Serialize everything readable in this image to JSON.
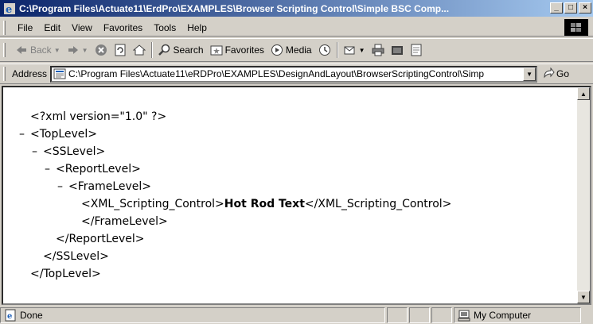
{
  "window": {
    "title": "C:\\Program Files\\Actuate11\\ErdPro\\EXAMPLES\\Browser Scripting Control\\Simple BSC Comp...",
    "controls": {
      "minimize": "_",
      "maximize": "□",
      "close": "×"
    }
  },
  "menu": {
    "items": [
      "File",
      "Edit",
      "View",
      "Favorites",
      "Tools",
      "Help"
    ]
  },
  "toolbar": {
    "back_label": "Back",
    "search_label": "Search",
    "favorites_label": "Favorites",
    "media_label": "Media"
  },
  "address": {
    "label": "Address",
    "url": "C:\\Program Files\\Actuate11\\eRDPro\\EXAMPLES\\DesignAndLayout\\BrowserScriptingControl\\Simp",
    "go_label": "Go"
  },
  "xml": {
    "declaration": "<?xml version=\"1.0\" ?>",
    "lines": [
      {
        "indent": 0,
        "toggle": "–",
        "text": "<TopLevel>"
      },
      {
        "indent": 1,
        "toggle": "–",
        "text": "<SSLevel>"
      },
      {
        "indent": 2,
        "toggle": "–",
        "text": "<ReportLevel>"
      },
      {
        "indent": 3,
        "toggle": "–",
        "text": "<FrameLevel>"
      }
    ],
    "element_open": "<XML_Scripting_Control>",
    "element_value": "Hot Rod Text",
    "element_close": "</XML_Scripting_Control>",
    "closing": [
      {
        "indent": 4,
        "text": "</FrameLevel>"
      },
      {
        "indent": 3,
        "text": "</ReportLevel>"
      },
      {
        "indent": 2,
        "text": "</SSLevel>"
      },
      {
        "indent": 1,
        "text": "</TopLevel>"
      }
    ]
  },
  "status": {
    "text": "Done",
    "zone": "My Computer"
  }
}
